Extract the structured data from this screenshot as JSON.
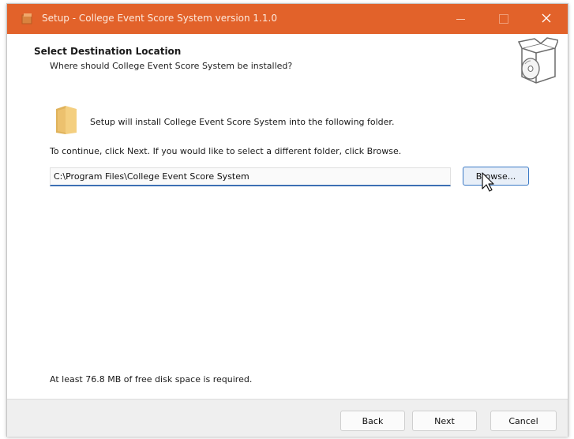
{
  "window": {
    "title": "Setup - College Event Score System version 1.1.0",
    "titlebar_color": "#e2622a"
  },
  "header": {
    "title": "Select Destination Location",
    "subtitle": "Where should College Event Score System be installed?"
  },
  "body": {
    "intro": "Setup will install College Event Score System into the following folder.",
    "continue": "To continue, click Next. If you would like to select a different folder, click Browse.",
    "path_value": "C:\\Program Files\\College Event Score System",
    "browse_label": "Browse...",
    "disk_space": "At least 76.8 MB of free disk space is required."
  },
  "footer": {
    "back_label": "Back",
    "next_label": "Next",
    "cancel_label": "Cancel"
  },
  "icons": {
    "app": "setup-app-icon",
    "header": "box-with-disc-icon",
    "folder": "folder-icon",
    "cursor": "mouse-pointer-icon"
  }
}
